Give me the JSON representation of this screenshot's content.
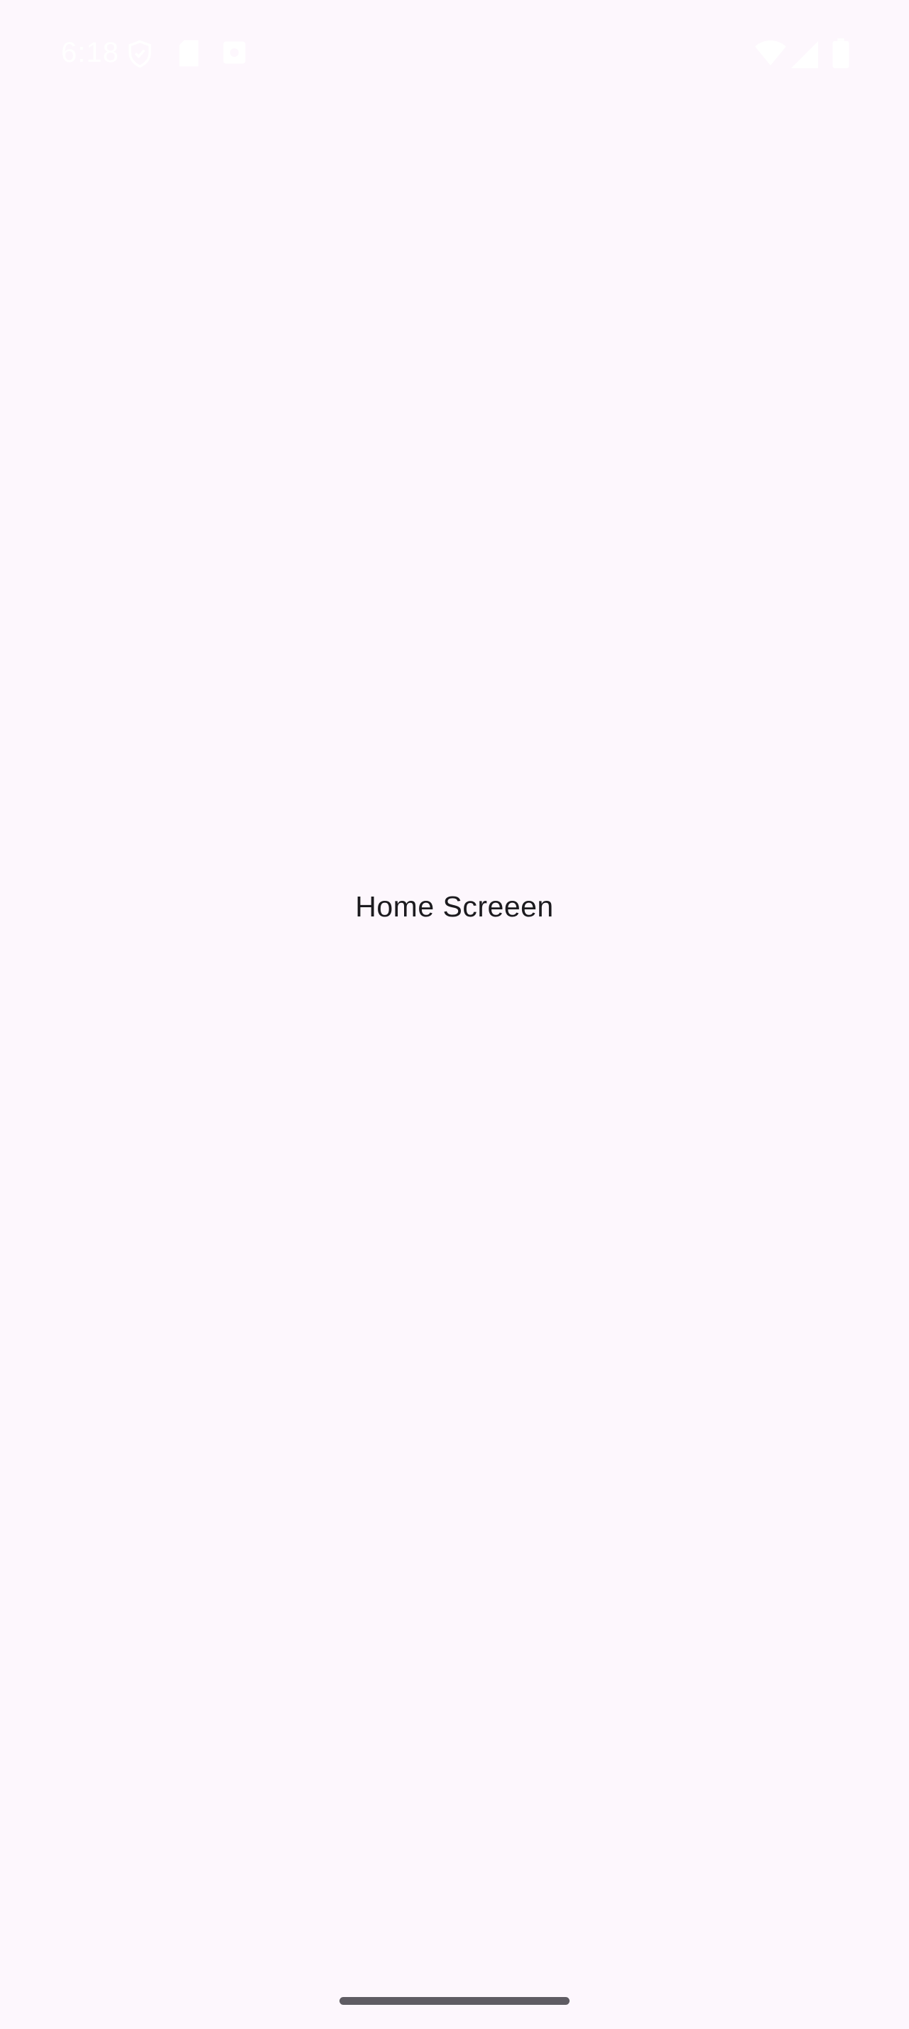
{
  "status_bar": {
    "time": "6:18",
    "left_icons": [
      "vpn-shield-icon",
      "sd-card-icon",
      "screen-record-icon"
    ],
    "right_icons": [
      "wifi-icon",
      "cellular-signal-icon",
      "battery-icon"
    ],
    "icon_color": "#ffffff"
  },
  "screen": {
    "title": "Home Screeen",
    "background": "#fdf7fd"
  },
  "navigation": {
    "gesture_handle_color": "#5f5c63"
  }
}
